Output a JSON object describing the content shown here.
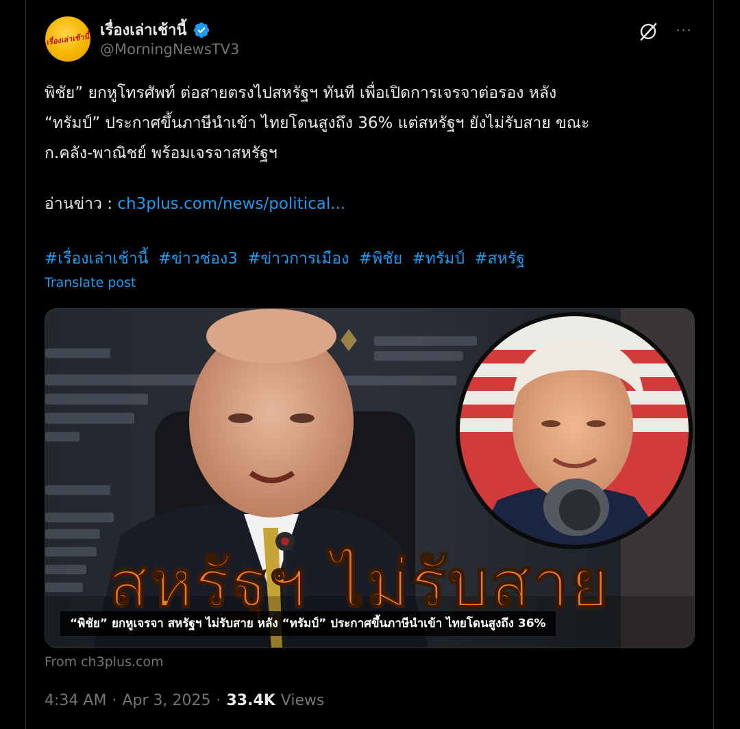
{
  "author": {
    "display_name": "เรื่องเล่าเช้านี้",
    "handle": "@MorningNewsTV3",
    "avatar_text": "เรื่องเล่าเช้านี้",
    "verified_icon": "verified-badge-icon"
  },
  "actions": {
    "grok_icon": "grok-icon",
    "more_label": "···"
  },
  "post": {
    "text": "พิชัย” ยกหูโทรศัพท์ ต่อสายตรงไปสหรัฐฯ ทันที เพื่อเปิดการเจรจาต่อรอง หลัง\n“ทรัมป์” ประกาศขึ้นภาษีนำเข้า ไทยโดนสูงถึง 36% แต่สหรัฐฯ ยังไม่รับสาย ขณะ\nก.คลัง-พาณิชย์ พร้อมเจรจาสหรัฐฯ",
    "read_label": "อ่านข่าว : ",
    "link_text": "ch3plus.com/news/political...",
    "hashtags": [
      "#เรื่องเล่าเช้านี้",
      "#ข่าวช่อง3",
      "#ข่าวการเมือง",
      "#พิชัย",
      "#ทรัมป์",
      "#สหรัฐ"
    ],
    "translate_label": "Translate post"
  },
  "media": {
    "headline": "สหรัฐฯ ไม่รับสาย",
    "caption": "“พิชัย” ยกหูเจรจา สหรัฐฯ ไม่รับสาย หลัง “ทรัมป์” ประกาศขึ้นภาษีนำเข้า ไทยโดนสูงถึง 36%",
    "source": "From ch3plus.com",
    "accent_color": "#f47a1f"
  },
  "meta": {
    "time": "4:34 AM",
    "sep1": "·",
    "date": "Apr 3, 2025",
    "sep2": "·",
    "views_count": "33.4K",
    "views_label": "Views"
  },
  "colors": {
    "background": "#000000",
    "text": "#e7e9ea",
    "muted": "#71767b",
    "link": "#1d9bf0",
    "border": "#2f3336"
  }
}
